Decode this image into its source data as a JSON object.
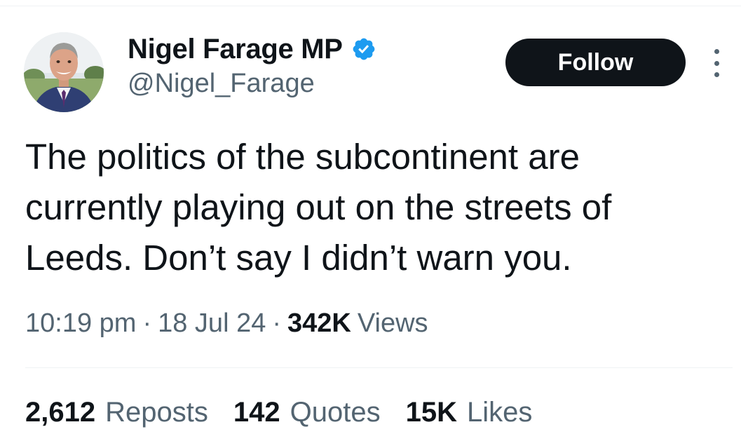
{
  "author": {
    "display_name": "Nigel Farage MP",
    "handle": "@Nigel_Farage",
    "verified_color": "#1d9bf0"
  },
  "actions": {
    "follow_label": "Follow"
  },
  "tweet": {
    "text": "The politics of the subcontinent are currently playing out on the streets of Leeds. Don’t say I didn’t warn you."
  },
  "meta": {
    "time": "10:19 pm",
    "separator": "·",
    "date": "18 Jul 24",
    "views_count": "342K",
    "views_label": "Views"
  },
  "stats": {
    "reposts_count": "2,612",
    "reposts_label": "Reposts",
    "quotes_count": "142",
    "quotes_label": "Quotes",
    "likes_count": "15K",
    "likes_label": "Likes"
  },
  "icons": {
    "verified": "verified-badge-icon",
    "more": "more-options-icon"
  }
}
